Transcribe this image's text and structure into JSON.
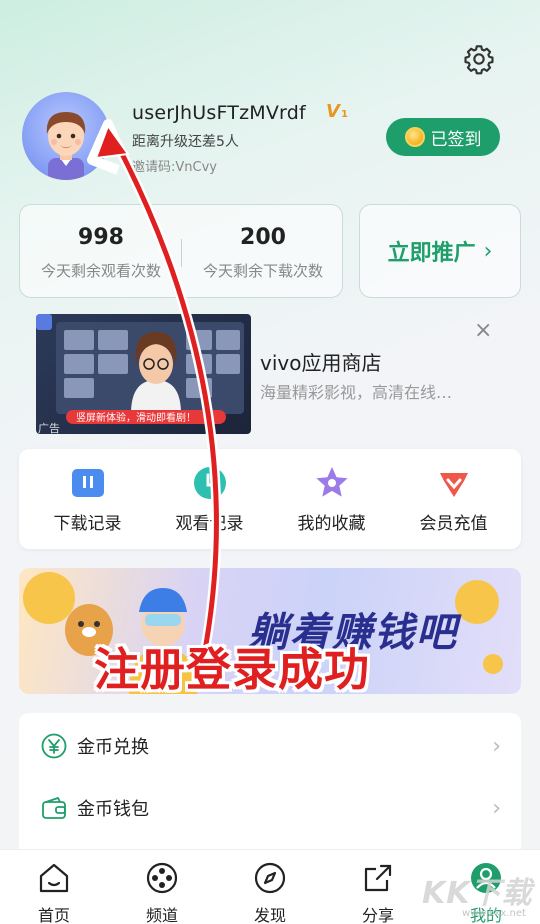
{
  "profile": {
    "username": "userJhUsFTzMVrdf",
    "vip_badge": "V",
    "vip_level": "1",
    "upgrade_text": "距离升级还差5人",
    "invite_code": "邀请码:VnCvy",
    "signed_label": "已签到"
  },
  "stats": {
    "watch_count": "998",
    "watch_label": "今天剩余观看次数",
    "download_count": "200",
    "download_label": "今天剩余下载次数",
    "promote_label": "立即推广"
  },
  "ad": {
    "title": "vivo应用商店",
    "subtitle": "海量精彩影视，高清在线…",
    "tag": "广告",
    "close": "×",
    "image_caption": "竖屏新体验，滑动即看剧！"
  },
  "shortcuts": [
    {
      "label": "下载记录",
      "icon": "download-record-icon",
      "color": "#4b8cf0"
    },
    {
      "label": "观看记录",
      "icon": "watch-record-icon",
      "color": "#2dbfb0"
    },
    {
      "label": "我的收藏",
      "icon": "favorite-star-icon",
      "color": "#9b7be8"
    },
    {
      "label": "会员充值",
      "icon": "vip-recharge-icon",
      "color": "#f0564a"
    }
  ],
  "banner": {
    "headline": "躺着赚钱吧",
    "overlay": "注册登录成功"
  },
  "menu": [
    {
      "label": "金币兑换",
      "icon": "coin-exchange-icon"
    },
    {
      "label": "金币钱包",
      "icon": "coin-wallet-icon"
    }
  ],
  "nav": [
    {
      "label": "首页",
      "icon": "home-icon"
    },
    {
      "label": "频道",
      "icon": "channel-icon"
    },
    {
      "label": "发现",
      "icon": "discover-icon"
    },
    {
      "label": "分享",
      "icon": "share-icon"
    },
    {
      "label": "我的",
      "icon": "profile-icon"
    }
  ],
  "watermark": {
    "text": "KK下载",
    "sub": "www.kkx.net"
  },
  "colors": {
    "accent": "#1e9e6a",
    "arrow": "#e02020"
  }
}
